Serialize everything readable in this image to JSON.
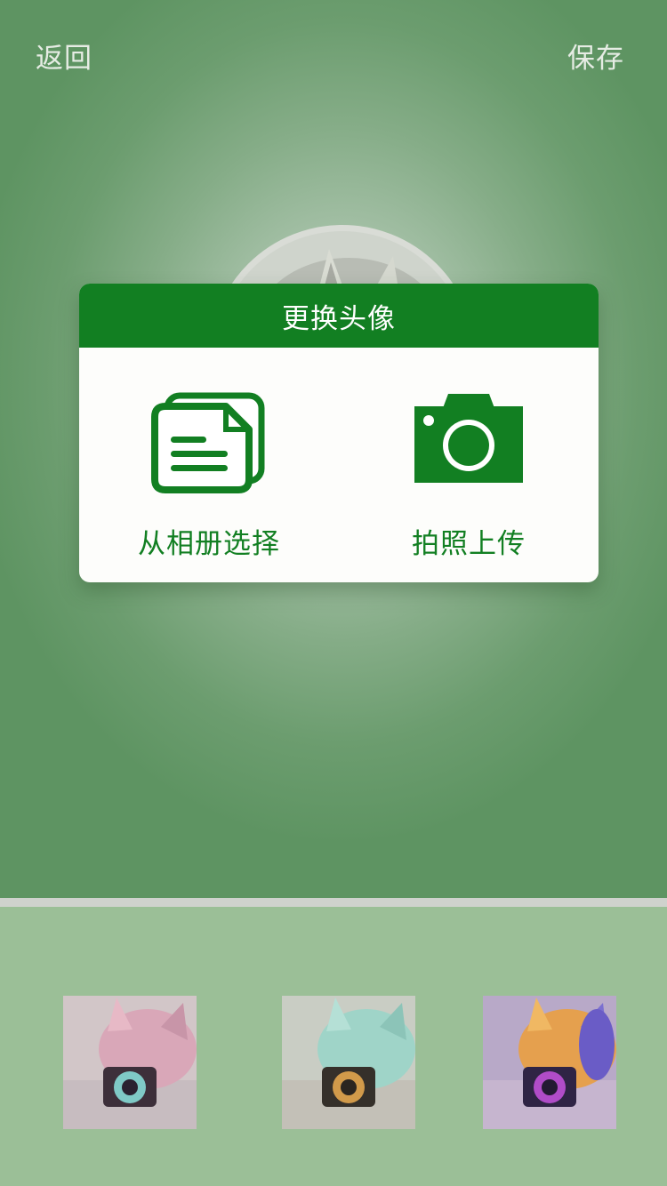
{
  "nav": {
    "back_label": "返回",
    "save_label": "保存"
  },
  "dialog": {
    "title": "更换头像",
    "options": [
      {
        "label": "从相册选择",
        "icon": "album-icon"
      },
      {
        "label": "拍照上传",
        "icon": "camera-icon"
      }
    ]
  },
  "colors": {
    "accent": "#127f22",
    "background_top": "#6c9d6f",
    "background_bottom": "#9bbf97",
    "nav_text": "#e6ece4"
  },
  "filters": [
    {
      "name": "filter-pink",
      "tint": "#d9a7b8"
    },
    {
      "name": "filter-cyan",
      "tint": "#9fd4c8"
    },
    {
      "name": "filter-vivid",
      "tint": "#7b6fd0"
    }
  ]
}
